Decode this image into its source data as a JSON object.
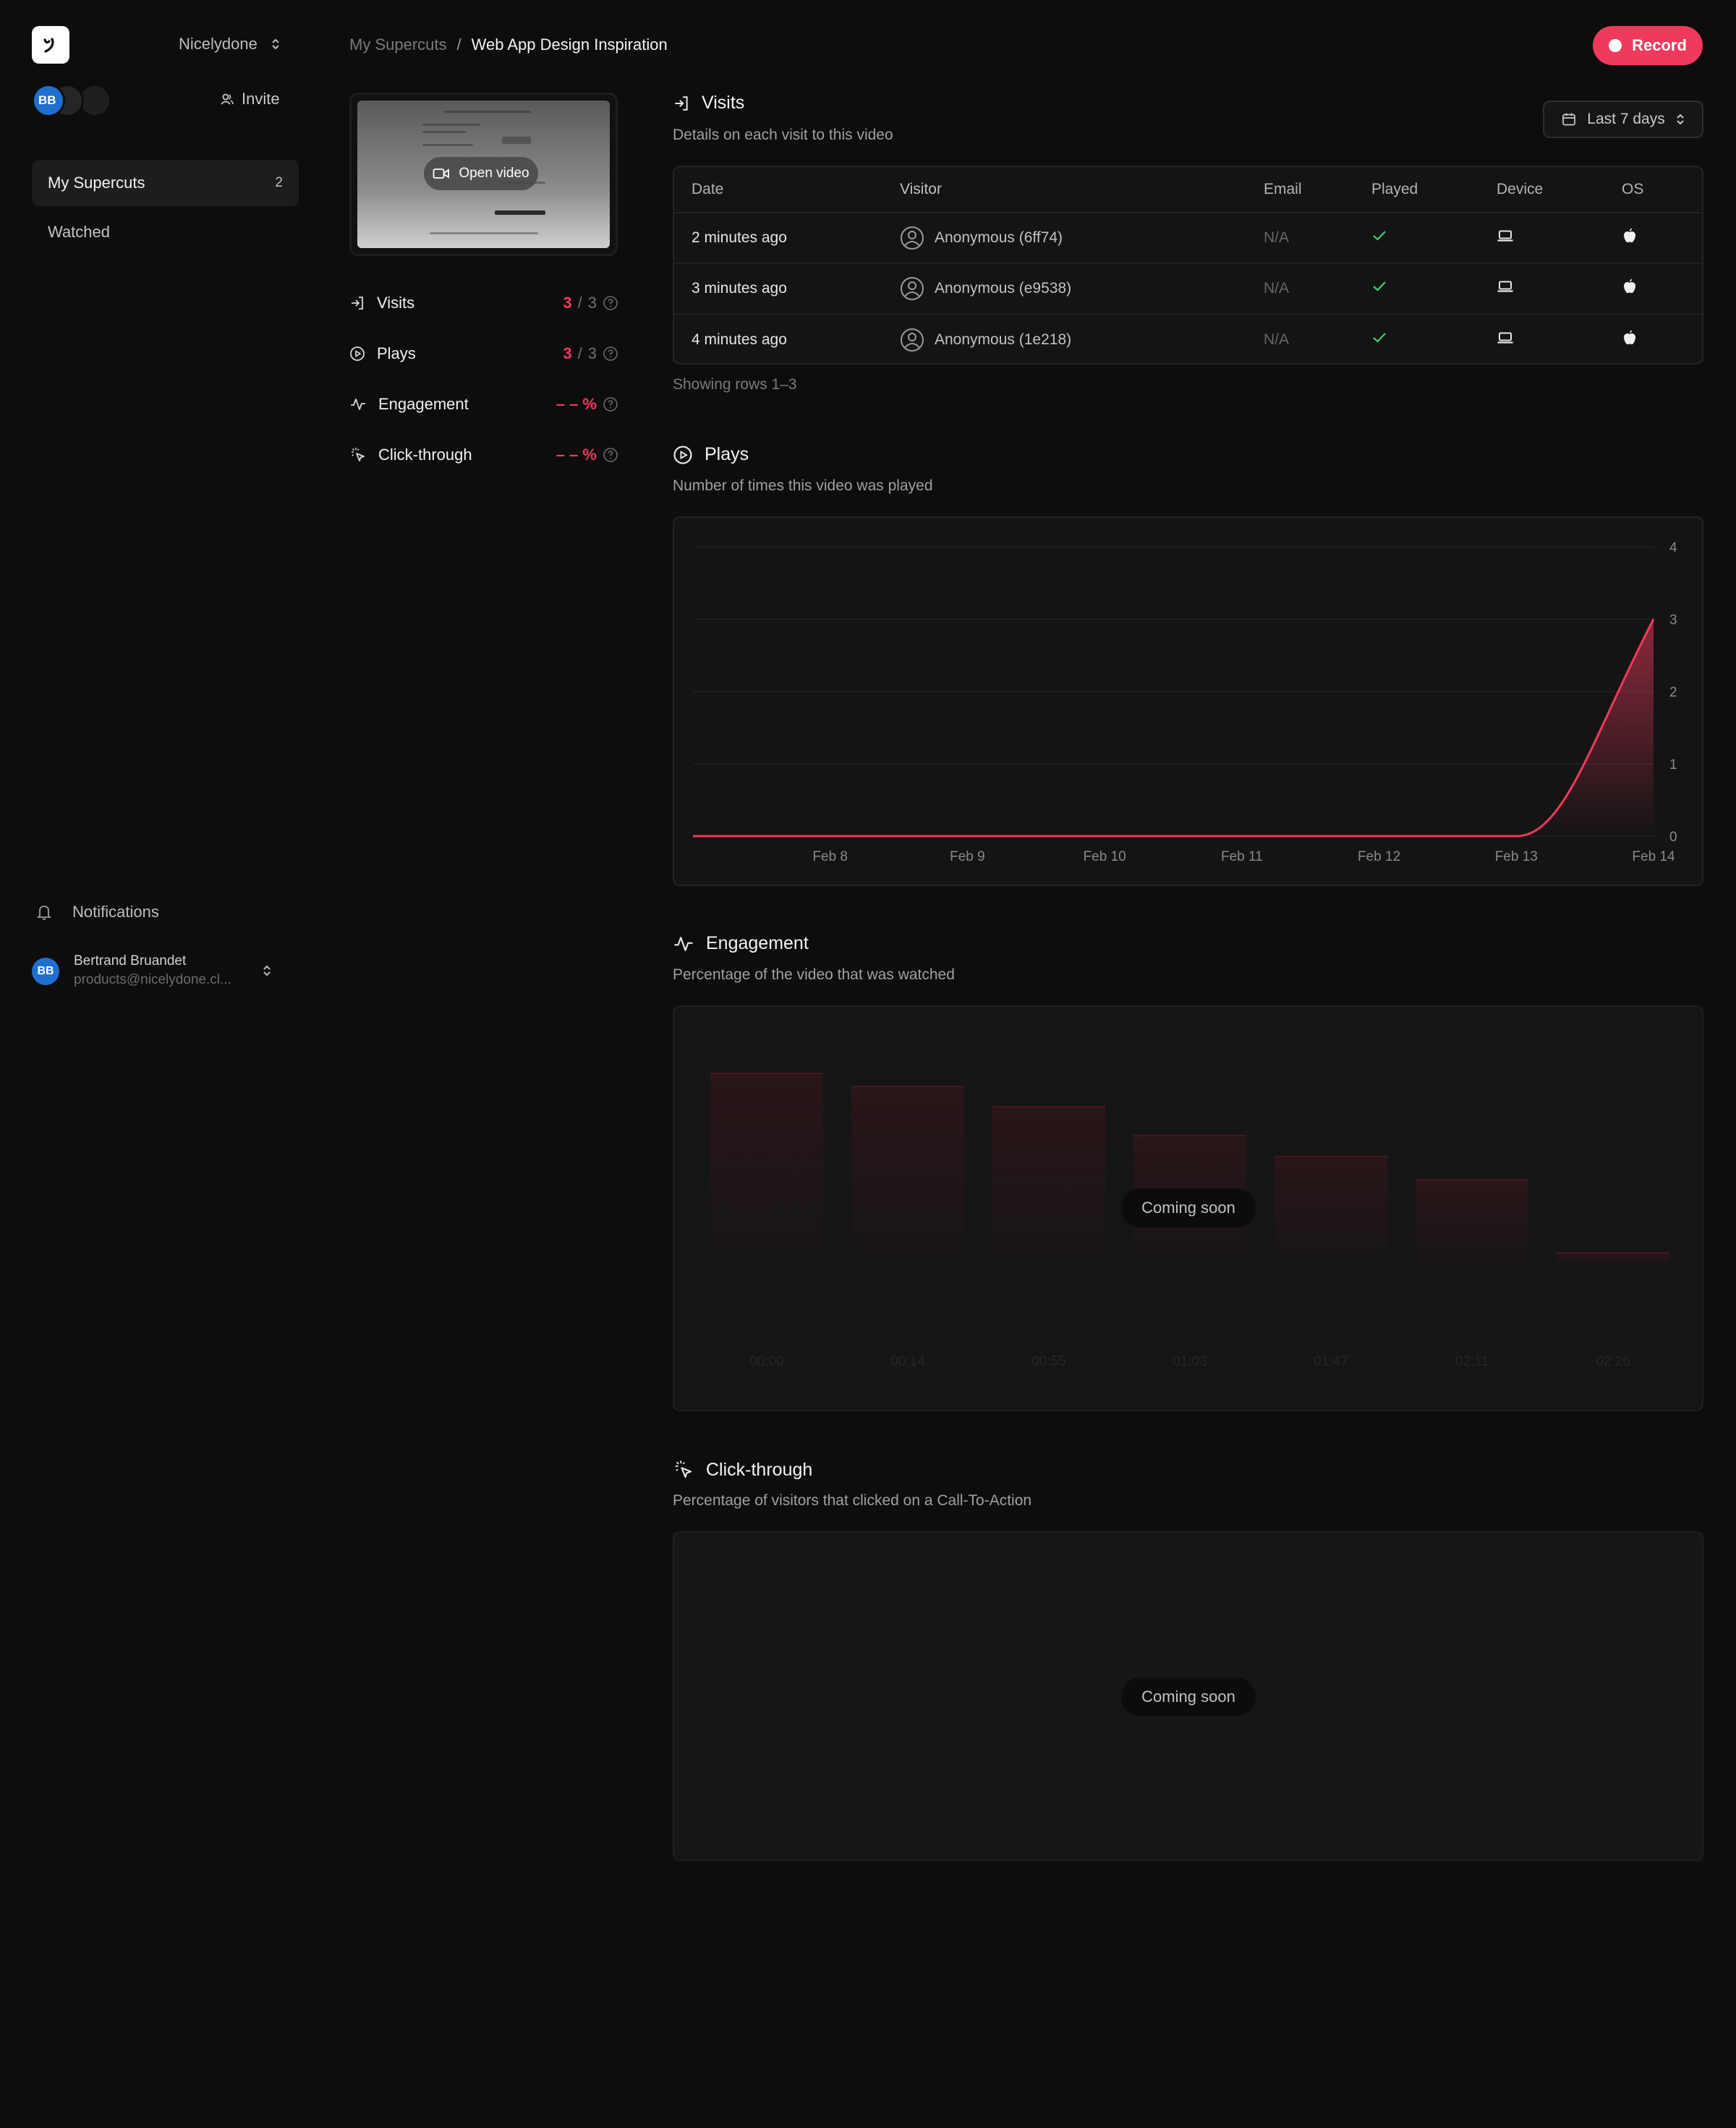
{
  "sidebar": {
    "workspace": "Nicelydone",
    "avatar_initials": "BB",
    "invite_label": "Invite",
    "nav": [
      {
        "label": "My Supercuts",
        "count": "2"
      },
      {
        "label": "Watched",
        "count": ""
      }
    ],
    "notifications_label": "Notifications",
    "user": {
      "initials": "BB",
      "name": "Bertrand Bruandet",
      "email": "products@nicelydone.cl..."
    }
  },
  "breadcrumb": {
    "root": "My Supercuts",
    "separator": "/",
    "current": "Web App Design Inspiration"
  },
  "record_label": "Record",
  "thumbnail": {
    "open_label": "Open video"
  },
  "metrics": [
    {
      "label": "Visits",
      "value": "3",
      "sep": "/",
      "total": "3"
    },
    {
      "label": "Plays",
      "value": "3",
      "sep": "/",
      "total": "3"
    },
    {
      "label": "Engagement",
      "value": "– – %"
    },
    {
      "label": "Click-through",
      "value": "– – %"
    }
  ],
  "visits": {
    "title": "Visits",
    "subtitle": "Details on each visit to this video",
    "range_label": "Last 7 days",
    "columns": [
      "Date",
      "Visitor",
      "Email",
      "Played",
      "Device",
      "OS"
    ],
    "rows": [
      {
        "date": "2 minutes ago",
        "visitor": "Anonymous (6ff74)",
        "email": "N/A"
      },
      {
        "date": "3 minutes ago",
        "visitor": "Anonymous (e9538)",
        "email": "N/A"
      },
      {
        "date": "4 minutes ago",
        "visitor": "Anonymous (1e218)",
        "email": "N/A"
      }
    ],
    "showing": "Showing rows 1–3"
  },
  "plays": {
    "title": "Plays",
    "subtitle": "Number of times this video was played"
  },
  "engagement": {
    "title": "Engagement",
    "subtitle": "Percentage of the video that was watched",
    "coming_soon": "Coming soon",
    "placeholder_labels": [
      "00:00",
      "00:14",
      "00:55",
      "01:03",
      "01:47",
      "02:11",
      "02:26"
    ],
    "placeholder_values": [
      0.74,
      0.69,
      0.61,
      0.5,
      0.42,
      0.33,
      0.05
    ]
  },
  "clickthrough": {
    "title": "Click-through",
    "subtitle": "Percentage of visitors that clicked on a Call-To-Action",
    "coming_soon": "Coming soon"
  },
  "colors": {
    "accent": "#f03a5b",
    "check": "#3ecf6e",
    "avatar": "#1f6fd1"
  },
  "chart_data": {
    "type": "area",
    "categories": [
      "Feb 8",
      "Feb 9",
      "Feb 10",
      "Feb 11",
      "Feb 12",
      "Feb 13",
      "Feb 14"
    ],
    "x": [
      "Feb 7",
      "Feb 8",
      "Feb 9",
      "Feb 10",
      "Feb 11",
      "Feb 12",
      "Feb 13",
      "Feb 14"
    ],
    "values": [
      0,
      0,
      0,
      0,
      0,
      0,
      0,
      3
    ],
    "ylim": [
      0,
      4
    ],
    "yticks": [
      "0",
      "1",
      "2",
      "3",
      "4"
    ],
    "grid": true,
    "y_axis_side": "right"
  }
}
